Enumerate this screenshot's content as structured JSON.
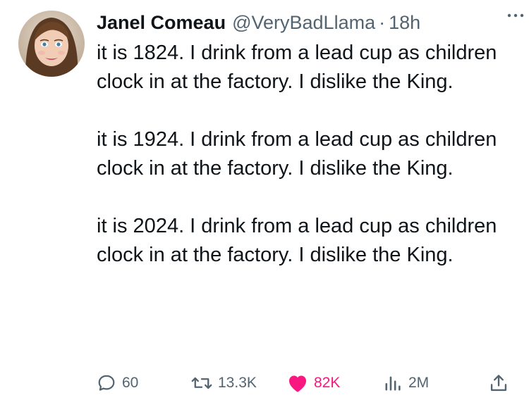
{
  "tweet": {
    "author": {
      "display_name": "Janel Comeau",
      "handle": "@VeryBadLlama",
      "separator": "·",
      "time": "18h"
    },
    "paragraphs": [
      "it is 1824. I drink from a lead cup as children clock in at the factory. I dislike the King.",
      "it is 1924. I drink from a lead cup as children clock in at the factory. I dislike the King.",
      "it is 2024. I drink from a lead cup as children clock in at the factory. I dislike the King."
    ],
    "actions": {
      "reply_count": "60",
      "retweet_count": "13.3K",
      "like_count": "82K",
      "views_count": "2M"
    }
  },
  "icons": {
    "more": "more-horizontal-icon",
    "reply": "reply-bubble-icon",
    "retweet": "retweet-arrows-icon",
    "like": "heart-filled-icon",
    "views": "bar-chart-icon",
    "share": "share-upload-icon"
  },
  "colors": {
    "text_primary": "#0f1419",
    "text_secondary": "#536471",
    "like_pink": "#f91880",
    "background": "#ffffff"
  }
}
